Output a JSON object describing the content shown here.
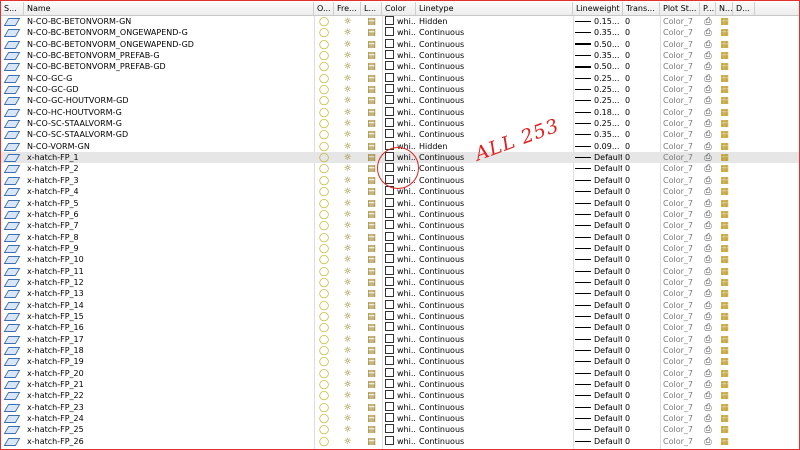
{
  "columns": {
    "status": "S...",
    "name": "Name",
    "on": "O...",
    "freeze": "Fre...",
    "lock": "L...",
    "color": "Color",
    "linetype": "Linetype",
    "lineweight": "Lineweight",
    "transparency": "Trans...",
    "plot_style": "Plot St...",
    "plot": "P...",
    "new_vp": "N...",
    "description": "D..."
  },
  "rows": [
    {
      "name": "N-CO-BC-BETONVORM-GN",
      "color": "whi...",
      "linetype": "Hidden",
      "lineweight": "0.15...",
      "transparency": "0",
      "plot_style": "Color_7"
    },
    {
      "name": "N-CO-BC-BETONVORM_ONGEWAPEND-G",
      "color": "whi...",
      "linetype": "Continuous",
      "lineweight": "0.35...",
      "transparency": "0",
      "plot_style": "Color_7"
    },
    {
      "name": "N-CO-BC-BETONVORM_ONGEWAPEND-GD",
      "color": "whi...",
      "linetype": "Continuous",
      "lineweight": "0.50...",
      "transparency": "0",
      "plot_style": "Color_7"
    },
    {
      "name": "N-CO-BC-BETONVORM_PREFAB-G",
      "color": "whi...",
      "linetype": "Continuous",
      "lineweight": "0.35...",
      "transparency": "0",
      "plot_style": "Color_7"
    },
    {
      "name": "N-CO-BC-BETONVORM_PREFAB-GD",
      "color": "whi...",
      "linetype": "Continuous",
      "lineweight": "0.50...",
      "transparency": "0",
      "plot_style": "Color_7"
    },
    {
      "name": "N-CO-GC-G",
      "color": "whi...",
      "linetype": "Continuous",
      "lineweight": "0.25...",
      "transparency": "0",
      "plot_style": "Color_7"
    },
    {
      "name": "N-CO-GC-GD",
      "color": "whi...",
      "linetype": "Continuous",
      "lineweight": "0.25...",
      "transparency": "0",
      "plot_style": "Color_7"
    },
    {
      "name": "N-CO-GC-HOUTVORM-GD",
      "color": "whi...",
      "linetype": "Continuous",
      "lineweight": "0.25...",
      "transparency": "0",
      "plot_style": "Color_7"
    },
    {
      "name": "N-CO-HC-HOUTVORM-G",
      "color": "whi...",
      "linetype": "Continuous",
      "lineweight": "0.18...",
      "transparency": "0",
      "plot_style": "Color_7"
    },
    {
      "name": "N-CO-SC-STAALVORM-G",
      "color": "whi...",
      "linetype": "Continuous",
      "lineweight": "0.25...",
      "transparency": "0",
      "plot_style": "Color_7"
    },
    {
      "name": "N-CO-SC-STAALVORM-GD",
      "color": "whi...",
      "linetype": "Continuous",
      "lineweight": "0.35...",
      "transparency": "0",
      "plot_style": "Color_7"
    },
    {
      "name": "N-CO-VORM-GN",
      "color": "whi...",
      "linetype": "Hidden",
      "lineweight": "0.09...",
      "transparency": "0",
      "plot_style": "Color_7"
    },
    {
      "name": "x-hatch-FP_1",
      "color": "whi...",
      "linetype": "Continuous",
      "lineweight": "Default",
      "transparency": "0",
      "plot_style": "Color_7"
    },
    {
      "name": "x-hatch-FP_2",
      "color": "whi...",
      "linetype": "Continuous",
      "lineweight": "Default",
      "transparency": "0",
      "plot_style": "Color_7"
    },
    {
      "name": "x-hatch-FP_3",
      "color": "whi...",
      "linetype": "Continuous",
      "lineweight": "Default",
      "transparency": "0",
      "plot_style": "Color_7"
    },
    {
      "name": "x-hatch-FP_4",
      "color": "whi...",
      "linetype": "Continuous",
      "lineweight": "Default",
      "transparency": "0",
      "plot_style": "Color_7"
    },
    {
      "name": "x-hatch-FP_5",
      "color": "whi...",
      "linetype": "Continuous",
      "lineweight": "Default",
      "transparency": "0",
      "plot_style": "Color_7"
    },
    {
      "name": "x-hatch-FP_6",
      "color": "whi...",
      "linetype": "Continuous",
      "lineweight": "Default",
      "transparency": "0",
      "plot_style": "Color_7"
    },
    {
      "name": "x-hatch-FP_7",
      "color": "whi...",
      "linetype": "Continuous",
      "lineweight": "Default",
      "transparency": "0",
      "plot_style": "Color_7"
    },
    {
      "name": "x-hatch-FP_8",
      "color": "whi...",
      "linetype": "Continuous",
      "lineweight": "Default",
      "transparency": "0",
      "plot_style": "Color_7"
    },
    {
      "name": "x-hatch-FP_9",
      "color": "whi...",
      "linetype": "Continuous",
      "lineweight": "Default",
      "transparency": "0",
      "plot_style": "Color_7"
    },
    {
      "name": "x-hatch-FP_10",
      "color": "whi...",
      "linetype": "Continuous",
      "lineweight": "Default",
      "transparency": "0",
      "plot_style": "Color_7"
    },
    {
      "name": "x-hatch-FP_11",
      "color": "whi...",
      "linetype": "Continuous",
      "lineweight": "Default",
      "transparency": "0",
      "plot_style": "Color_7"
    },
    {
      "name": "x-hatch-FP_12",
      "color": "whi...",
      "linetype": "Continuous",
      "lineweight": "Default",
      "transparency": "0",
      "plot_style": "Color_7"
    },
    {
      "name": "x-hatch-FP_13",
      "color": "whi...",
      "linetype": "Continuous",
      "lineweight": "Default",
      "transparency": "0",
      "plot_style": "Color_7"
    },
    {
      "name": "x-hatch-FP_14",
      "color": "whi...",
      "linetype": "Continuous",
      "lineweight": "Default",
      "transparency": "0",
      "plot_style": "Color_7"
    },
    {
      "name": "x-hatch-FP_15",
      "color": "whi...",
      "linetype": "Continuous",
      "lineweight": "Default",
      "transparency": "0",
      "plot_style": "Color_7"
    },
    {
      "name": "x-hatch-FP_16",
      "color": "whi...",
      "linetype": "Continuous",
      "lineweight": "Default",
      "transparency": "0",
      "plot_style": "Color_7"
    },
    {
      "name": "x-hatch-FP_17",
      "color": "whi...",
      "linetype": "Continuous",
      "lineweight": "Default",
      "transparency": "0",
      "plot_style": "Color_7"
    },
    {
      "name": "x-hatch-FP_18",
      "color": "whi...",
      "linetype": "Continuous",
      "lineweight": "Default",
      "transparency": "0",
      "plot_style": "Color_7"
    },
    {
      "name": "x-hatch-FP_19",
      "color": "whi...",
      "linetype": "Continuous",
      "lineweight": "Default",
      "transparency": "0",
      "plot_style": "Color_7"
    },
    {
      "name": "x-hatch-FP_20",
      "color": "whi...",
      "linetype": "Continuous",
      "lineweight": "Default",
      "transparency": "0",
      "plot_style": "Color_7"
    },
    {
      "name": "x-hatch-FP_21",
      "color": "whi...",
      "linetype": "Continuous",
      "lineweight": "Default",
      "transparency": "0",
      "plot_style": "Color_7"
    },
    {
      "name": "x-hatch-FP_22",
      "color": "whi...",
      "linetype": "Continuous",
      "lineweight": "Default",
      "transparency": "0",
      "plot_style": "Color_7"
    },
    {
      "name": "x-hatch-FP_23",
      "color": "whi...",
      "linetype": "Continuous",
      "lineweight": "Default",
      "transparency": "0",
      "plot_style": "Color_7"
    },
    {
      "name": "x-hatch-FP_24",
      "color": "whi...",
      "linetype": "Continuous",
      "lineweight": "Default",
      "transparency": "0",
      "plot_style": "Color_7"
    },
    {
      "name": "x-hatch-FP_25",
      "color": "whi...",
      "linetype": "Continuous",
      "lineweight": "Default",
      "transparency": "0",
      "plot_style": "Color_7"
    },
    {
      "name": "x-hatch-FP_26",
      "color": "whi...",
      "linetype": "Continuous",
      "lineweight": "Default",
      "transparency": "0",
      "plot_style": "Color_7"
    }
  ],
  "selected_row": "x-hatch-FP_1",
  "annotation": {
    "text": "ALL 253",
    "color": "#e02020"
  },
  "icons": {
    "status": "layer-sheet-icon",
    "on": "lightbulb-icon",
    "freeze": "sun-icon",
    "lock": "padlock-icon",
    "plot": "printer-icon",
    "new_vp": "new-viewport-icon"
  }
}
